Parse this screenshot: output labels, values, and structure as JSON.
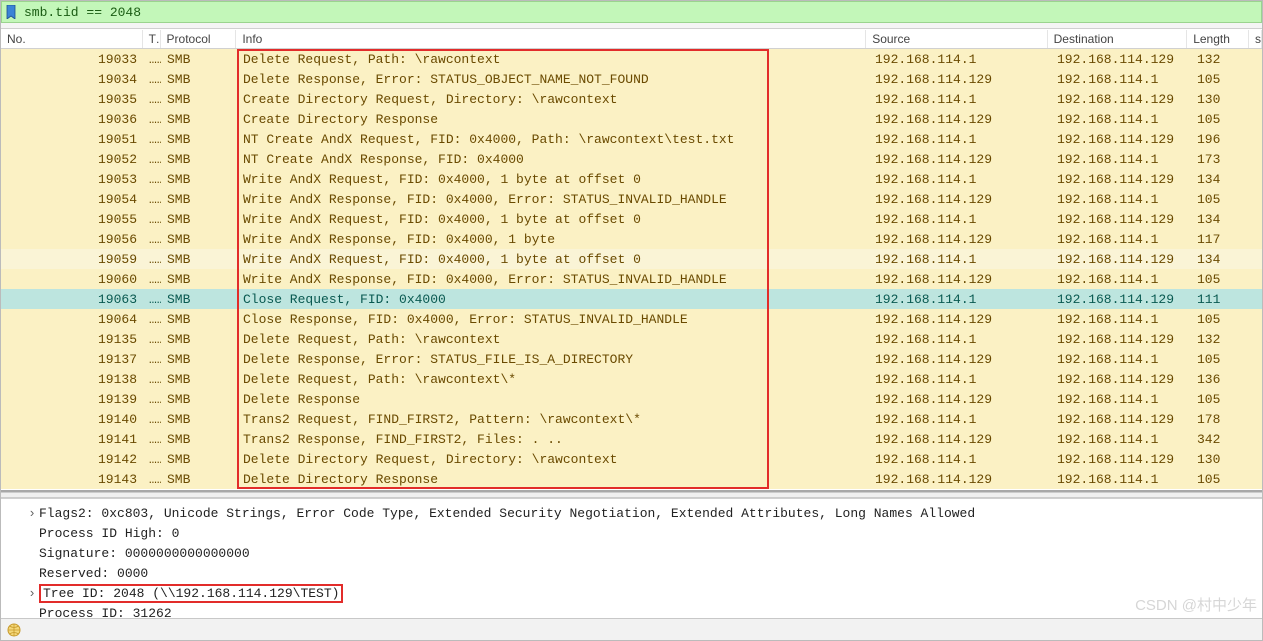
{
  "filter": {
    "expression": "smb.tid == 2048"
  },
  "columns": {
    "no": "No.",
    "time": "Ti",
    "protocol": "Protocol",
    "info": "Info",
    "source": "Source",
    "destination": "Destination",
    "length": "Length",
    "extra": "s"
  },
  "packets": [
    {
      "no": "19033",
      "ti": "…",
      "proto": "SMB",
      "info": "Delete Request, Path: \\rawcontext",
      "src": "192.168.114.1",
      "dst": "192.168.114.129",
      "len": "132",
      "sel": false
    },
    {
      "no": "19034",
      "ti": "…",
      "proto": "SMB",
      "info": "Delete Response, Error: STATUS_OBJECT_NAME_NOT_FOUND",
      "src": "192.168.114.129",
      "dst": "192.168.114.1",
      "len": "105",
      "sel": false
    },
    {
      "no": "19035",
      "ti": "…",
      "proto": "SMB",
      "info": "Create Directory Request, Directory: \\rawcontext",
      "src": "192.168.114.1",
      "dst": "192.168.114.129",
      "len": "130",
      "sel": false
    },
    {
      "no": "19036",
      "ti": "…",
      "proto": "SMB",
      "info": "Create Directory Response",
      "src": "192.168.114.129",
      "dst": "192.168.114.1",
      "len": "105",
      "sel": false
    },
    {
      "no": "19051",
      "ti": "…",
      "proto": "SMB",
      "info": "NT Create AndX Request, FID: 0x4000, Path: \\rawcontext\\test.txt",
      "src": "192.168.114.1",
      "dst": "192.168.114.129",
      "len": "196",
      "sel": false
    },
    {
      "no": "19052",
      "ti": "…",
      "proto": "SMB",
      "info": "NT Create AndX Response, FID: 0x4000",
      "src": "192.168.114.129",
      "dst": "192.168.114.1",
      "len": "173",
      "sel": false
    },
    {
      "no": "19053",
      "ti": "…",
      "proto": "SMB",
      "info": "Write AndX Request, FID: 0x4000, 1 byte at offset 0",
      "src": "192.168.114.1",
      "dst": "192.168.114.129",
      "len": "134",
      "sel": false
    },
    {
      "no": "19054",
      "ti": "…",
      "proto": "SMB",
      "info": "Write AndX Response, FID: 0x4000, Error: STATUS_INVALID_HANDLE",
      "src": "192.168.114.129",
      "dst": "192.168.114.1",
      "len": "105",
      "sel": false
    },
    {
      "no": "19055",
      "ti": "…",
      "proto": "SMB",
      "info": "Write AndX Request, FID: 0x4000, 1 byte at offset 0",
      "src": "192.168.114.1",
      "dst": "192.168.114.129",
      "len": "134",
      "sel": false
    },
    {
      "no": "19056",
      "ti": "…",
      "proto": "SMB",
      "info": "Write AndX Response, FID: 0x4000, 1 byte",
      "src": "192.168.114.129",
      "dst": "192.168.114.1",
      "len": "117",
      "sel": false
    },
    {
      "no": "19059",
      "ti": "…",
      "proto": "SMB",
      "info": "Write AndX Request, FID: 0x4000, 1 byte at offset 0",
      "src": "192.168.114.1",
      "dst": "192.168.114.129",
      "len": "134",
      "sel": false,
      "alt": true
    },
    {
      "no": "19060",
      "ti": "…",
      "proto": "SMB",
      "info": "Write AndX Response, FID: 0x4000, Error: STATUS_INVALID_HANDLE",
      "src": "192.168.114.129",
      "dst": "192.168.114.1",
      "len": "105",
      "sel": false
    },
    {
      "no": "19063",
      "ti": "…",
      "proto": "SMB",
      "info": "Close Request, FID: 0x4000",
      "src": "192.168.114.1",
      "dst": "192.168.114.129",
      "len": "111",
      "sel": true
    },
    {
      "no": "19064",
      "ti": "…",
      "proto": "SMB",
      "info": "Close Response, FID: 0x4000, Error: STATUS_INVALID_HANDLE",
      "src": "192.168.114.129",
      "dst": "192.168.114.1",
      "len": "105",
      "sel": false
    },
    {
      "no": "19135",
      "ti": "…",
      "proto": "SMB",
      "info": "Delete Request, Path: \\rawcontext",
      "src": "192.168.114.1",
      "dst": "192.168.114.129",
      "len": "132",
      "sel": false
    },
    {
      "no": "19137",
      "ti": "…",
      "proto": "SMB",
      "info": "Delete Response, Error: STATUS_FILE_IS_A_DIRECTORY",
      "src": "192.168.114.129",
      "dst": "192.168.114.1",
      "len": "105",
      "sel": false
    },
    {
      "no": "19138",
      "ti": "…",
      "proto": "SMB",
      "info": "Delete Request, Path: \\rawcontext\\*",
      "src": "192.168.114.1",
      "dst": "192.168.114.129",
      "len": "136",
      "sel": false
    },
    {
      "no": "19139",
      "ti": "…",
      "proto": "SMB",
      "info": "Delete Response",
      "src": "192.168.114.129",
      "dst": "192.168.114.1",
      "len": "105",
      "sel": false
    },
    {
      "no": "19140",
      "ti": "…",
      "proto": "SMB",
      "info": "Trans2 Request, FIND_FIRST2, Pattern: \\rawcontext\\*",
      "src": "192.168.114.1",
      "dst": "192.168.114.129",
      "len": "178",
      "sel": false
    },
    {
      "no": "19141",
      "ti": "…",
      "proto": "SMB",
      "info": "Trans2 Response, FIND_FIRST2, Files: . ..",
      "src": "192.168.114.129",
      "dst": "192.168.114.1",
      "len": "342",
      "sel": false
    },
    {
      "no": "19142",
      "ti": "…",
      "proto": "SMB",
      "info": "Delete Directory Request, Directory: \\rawcontext",
      "src": "192.168.114.1",
      "dst": "192.168.114.129",
      "len": "130",
      "sel": false
    },
    {
      "no": "19143",
      "ti": "…",
      "proto": "SMB",
      "info": "Delete Directory Response",
      "src": "192.168.114.129",
      "dst": "192.168.114.1",
      "len": "105",
      "sel": false
    }
  ],
  "details": {
    "flags2": "Flags2: 0xc803, Unicode Strings, Error Code Type, Extended Security Negotiation, Extended Attributes, Long Names Allowed",
    "pid_high": "Process ID High: 0",
    "signature": "Signature: 0000000000000000",
    "reserved": "Reserved: 0000",
    "tree_id": "Tree ID: 2048  (\\\\192.168.114.129\\TEST)",
    "pid": "Process ID: 31262"
  },
  "watermark": "CSDN @村中少年",
  "status": {
    "right": ""
  }
}
